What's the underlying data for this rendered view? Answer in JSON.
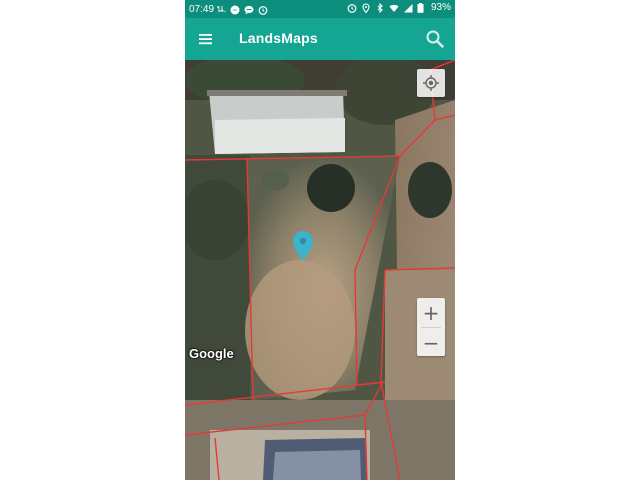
{
  "status_bar": {
    "time": "07:49 น.",
    "battery": "93%"
  },
  "app_bar": {
    "title": "LandsMaps",
    "menu_icon": "menu-icon",
    "search_icon": "search-icon"
  },
  "map": {
    "attribution": "Google",
    "map_type": "satellite",
    "parcel_line_color": "#e53935",
    "pin_color": "#3cb3c9",
    "controls": {
      "locate_icon": "my-location-icon",
      "zoom_in_label": "+",
      "zoom_out_label": "−"
    }
  },
  "colors": {
    "status_bar": "#0d8e7c",
    "app_bar": "#15a593"
  }
}
